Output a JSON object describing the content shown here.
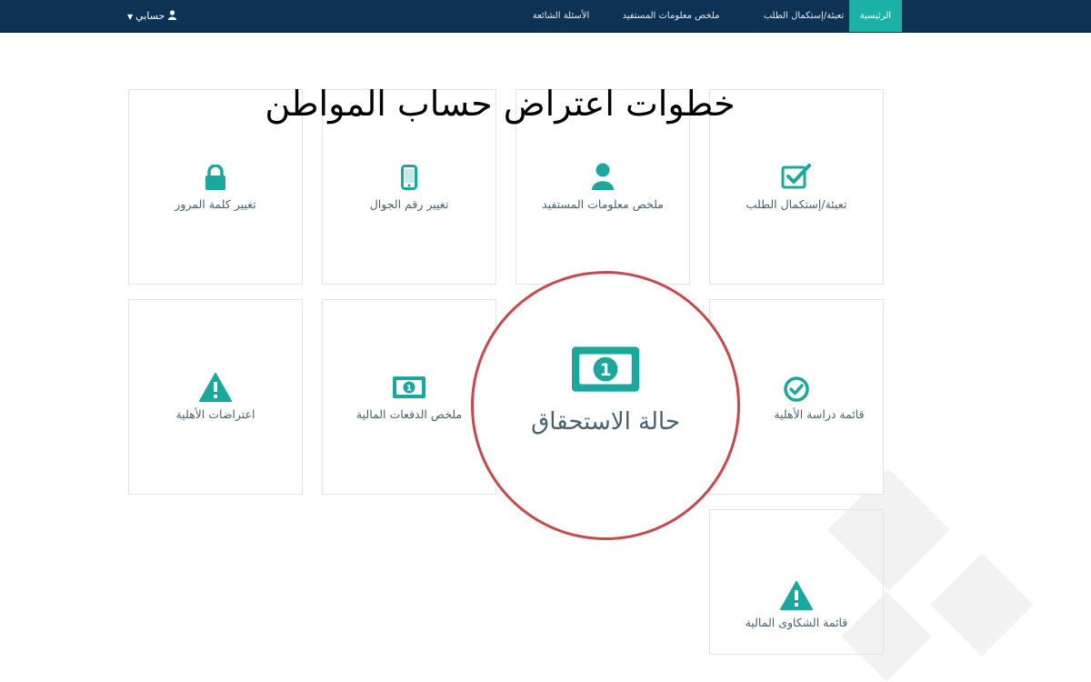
{
  "nav": {
    "items": [
      {
        "label": "الرئيسية",
        "active": true
      },
      {
        "label": "تعبئة/إستكمال الطلب",
        "active": false
      },
      {
        "label": "ملخص معلومات المستفيد",
        "active": false
      },
      {
        "label": "الأسئلة الشائعة",
        "active": false
      }
    ],
    "account_label": "حسابي"
  },
  "overlay_title": "خطوات اعتراض حساب المواطن",
  "tiles": [
    {
      "label": "تعبئة/إستكمال الطلب",
      "icon": "checkbox-icon"
    },
    {
      "label": "ملخص معلومات المستفيد",
      "icon": "user-icon"
    },
    {
      "label": "تغيير رقم الجوال",
      "icon": "mobile-phone-icon"
    },
    {
      "label": "تغيير كلمة المرور",
      "icon": "lock-icon"
    },
    {
      "label": "قائمة دراسة الأهلية",
      "icon": "check-circle-icon"
    },
    {
      "label": "ملخص الدفعات المالية",
      "icon": "money-icon"
    },
    {
      "label": "اعتراضات الأهلية",
      "icon": "warning-icon"
    },
    {
      "label": "قائمة الشكاوى المالية",
      "icon": "warning-icon"
    }
  ],
  "highlight": {
    "label": "حالة الاستحقاق",
    "icon": "money-icon"
  },
  "colors": {
    "navbar": "#0e3254",
    "active_tab": "#1bb1a6",
    "icon": "#1ba89c",
    "label": "#466270",
    "highlight_ring": "#c8484e"
  }
}
